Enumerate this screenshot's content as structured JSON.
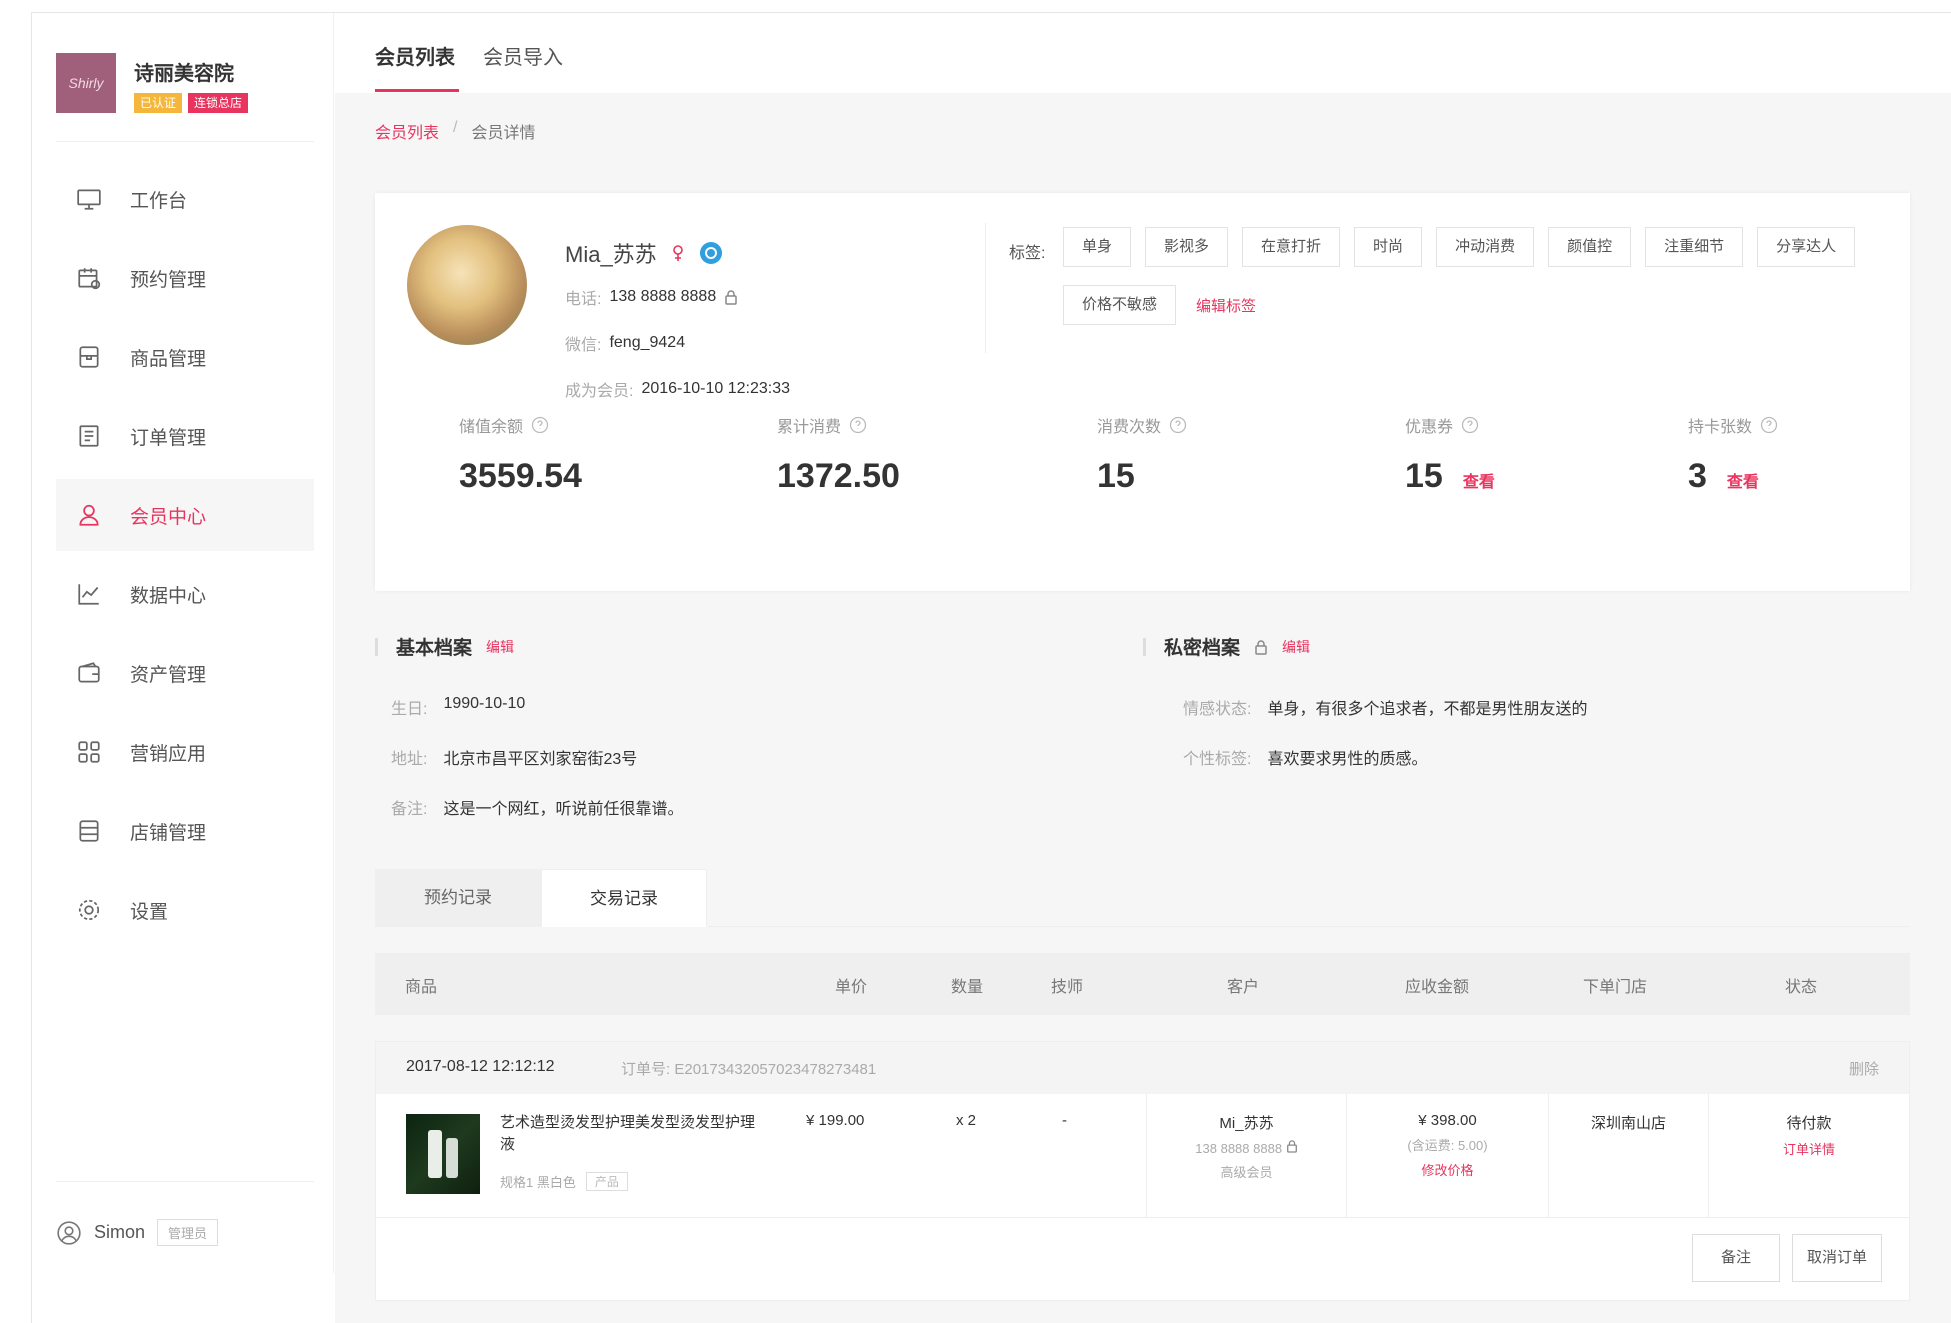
{
  "brand": {
    "logo_text": "Shirly",
    "name": "诗丽美容院",
    "tag_a": "已认证",
    "tag_b": "连锁总店"
  },
  "nav": [
    {
      "label": "工作台",
      "icon": "monitor-icon"
    },
    {
      "label": "预约管理",
      "icon": "calendar-icon"
    },
    {
      "label": "商品管理",
      "icon": "box-icon"
    },
    {
      "label": "订单管理",
      "icon": "order-icon"
    },
    {
      "label": "会员中心",
      "icon": "member-icon",
      "active": true
    },
    {
      "label": "数据中心",
      "icon": "chart-icon"
    },
    {
      "label": "资产管理",
      "icon": "wallet-icon"
    },
    {
      "label": "营销应用",
      "icon": "grid-icon"
    },
    {
      "label": "店铺管理",
      "icon": "store-icon"
    },
    {
      "label": "设置",
      "icon": "gear-icon"
    }
  ],
  "user": {
    "name": "Simon",
    "role": "管理员"
  },
  "top_tabs": [
    "会员列表",
    "会员导入"
  ],
  "breadcrumb": {
    "link": "会员列表",
    "sep": "/",
    "current": "会员详情"
  },
  "profile": {
    "name": "Mia_苏苏",
    "phone_label": "电话:",
    "phone": "138 8888 8888",
    "wechat_label": "微信:",
    "wechat": "feng_9424",
    "join_label": "成为会员:",
    "join_date": "2016-10-10 12:23:33",
    "tags_label": "标签:",
    "tags": [
      "单身",
      "影视多",
      "在意打折",
      "时尚",
      "冲动消费",
      "颜值控",
      "注重细节",
      "分享达人",
      "价格不敏感"
    ],
    "tags_edit": "编辑标签"
  },
  "stats": [
    {
      "label": "储值余额",
      "value": "3559.54",
      "link": ""
    },
    {
      "label": "累计消费",
      "value": "1372.50",
      "link": ""
    },
    {
      "label": "消费次数",
      "value": "15",
      "link": ""
    },
    {
      "label": "优惠券",
      "value": "15",
      "link": "查看"
    },
    {
      "label": "持卡张数",
      "value": "3",
      "link": "查看"
    }
  ],
  "basic": {
    "title": "基本档案",
    "edit": "编辑",
    "rows": [
      {
        "k": "生日:",
        "v": "1990-10-10"
      },
      {
        "k": "地址:",
        "v": "北京市昌平区刘家窑街23号"
      },
      {
        "k": "备注:",
        "v": "这是一个网红，听说前任很靠谱。"
      }
    ]
  },
  "private": {
    "title": "私密档案",
    "edit": "编辑",
    "rows": [
      {
        "k": "情感状态:",
        "v": "单身，有很多个追求者，不都是男性朋友送的"
      },
      {
        "k": "个性标签:",
        "v": "喜欢要求男性的质感。"
      }
    ]
  },
  "record_tabs": [
    "预约记录",
    "交易记录"
  ],
  "table_headers": [
    "商品",
    "单价",
    "数量",
    "技师",
    "客户",
    "应收金额",
    "下单门店",
    "状态"
  ],
  "order": {
    "date": "2017-08-12 12:12:12",
    "no_label": "订单号:",
    "no": "E20173432057023478273481",
    "delete": "删除",
    "product_title": "艺术造型烫发型护理美发型烫发型护理液",
    "product_spec": "规格1 黑白色",
    "product_tag": "产品",
    "unit_price": "¥ 199.00",
    "qty": "x 2",
    "tech": "-",
    "customer_name": "Mi_苏苏",
    "customer_phone": "138 8888 8888",
    "customer_level": "高级会员",
    "amount": "¥ 398.00",
    "amount_note": "(含运费: 5.00)",
    "amount_link": "修改价格",
    "store": "深圳南山店",
    "status": "待付款",
    "status_link": "订单详情",
    "btn_note": "备注",
    "btn_cancel": "取消订单"
  },
  "colors": {
    "accent": "#e8345f",
    "brand": "#a0607c"
  }
}
